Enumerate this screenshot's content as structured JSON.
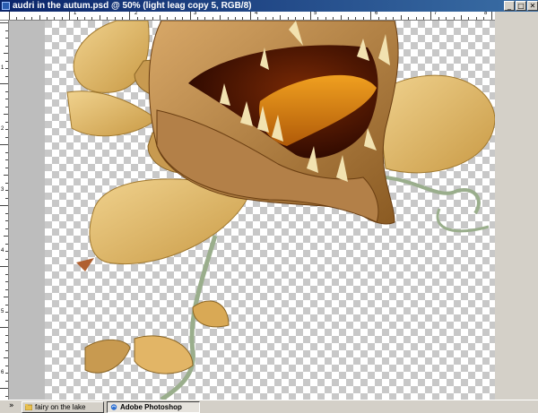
{
  "window": {
    "title": "audri in the autum.psd @ 50% (light leag copy 5, RGB/8)",
    "minimize_glyph": "_",
    "maximize_glyph": "□",
    "close_glyph": "✕"
  },
  "rulers": {
    "top_labels": [
      "1",
      "2",
      "3",
      "4",
      "5",
      "6",
      "7",
      "8"
    ],
    "left_labels": [
      "1",
      "2",
      "3",
      "4",
      "5",
      "6"
    ]
  },
  "taskbar": {
    "expand_glyph": "»",
    "items": [
      {
        "label": "fairy on the lake",
        "icon": "folder-icon",
        "active": false
      },
      {
        "label": "Adobe Photoshop",
        "icon": "photoshop-icon",
        "active": true
      }
    ]
  },
  "colors": {
    "titlebar_start": "#0a246a",
    "titlebar_end": "#3a6ea5",
    "leaf": "#e2b566",
    "vine": "#9aae8c",
    "mouth": "#3a0a00"
  }
}
